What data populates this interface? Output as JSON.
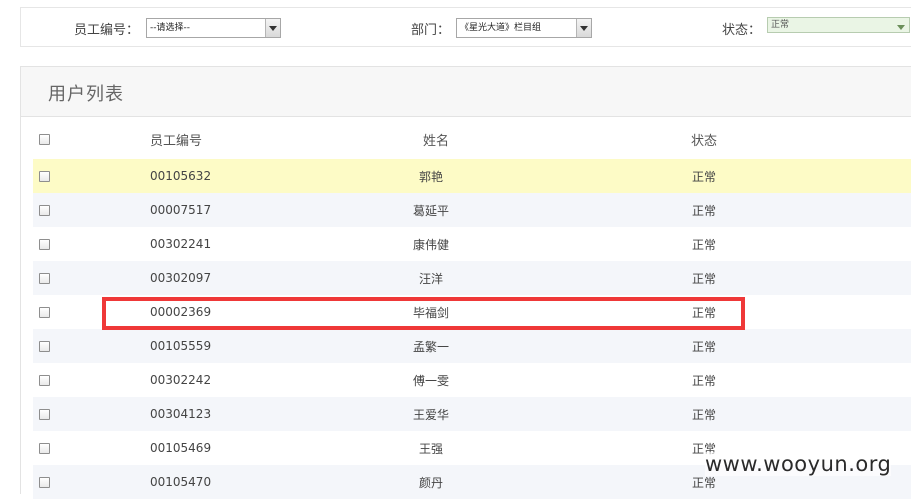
{
  "filters": {
    "employee_id_label": "员工编号：",
    "employee_id_value": "--请选择--",
    "department_label": "部门：",
    "department_value": "《星光大道》栏目组",
    "status_label": "状态：",
    "status_value": "正常"
  },
  "panel": {
    "title": "用户列表"
  },
  "table": {
    "headers": {
      "employee_id": "员工编号",
      "name": "姓名",
      "status": "状态"
    },
    "rows": [
      {
        "employee_id": "00105632",
        "name": "郭艳",
        "status": "正常"
      },
      {
        "employee_id": "00007517",
        "name": "葛延平",
        "status": "正常"
      },
      {
        "employee_id": "00302241",
        "name": "康伟健",
        "status": "正常"
      },
      {
        "employee_id": "00302097",
        "name": "汪洋",
        "status": "正常"
      },
      {
        "employee_id": "00002369",
        "name": "毕福剑",
        "status": "正常"
      },
      {
        "employee_id": "00105559",
        "name": "孟繁一",
        "status": "正常"
      },
      {
        "employee_id": "00302242",
        "name": "傅一雯",
        "status": "正常"
      },
      {
        "employee_id": "00304123",
        "name": "王爱华",
        "status": "正常"
      },
      {
        "employee_id": "00105469",
        "name": "王强",
        "status": "正常"
      },
      {
        "employee_id": "00105470",
        "name": "颜丹",
        "status": "正常"
      }
    ]
  },
  "watermark": "www.wooyun.org",
  "colors": {
    "highlight_row": "#fdfbc6",
    "alt_row": "#f4f6fa",
    "annotation_box": "#ef3838"
  }
}
